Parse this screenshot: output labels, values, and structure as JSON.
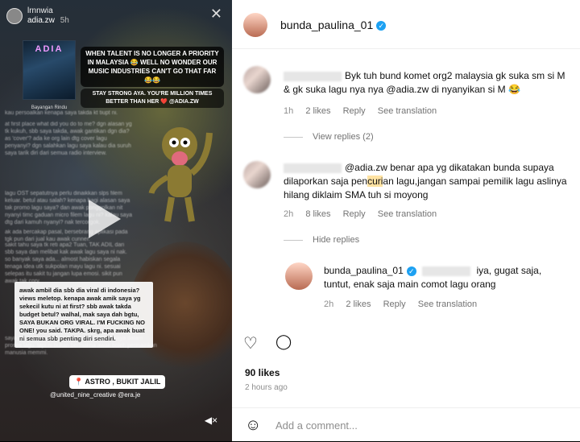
{
  "story": {
    "user_top": "lrnnwia",
    "user_handle": "adia.zw",
    "time": "5h",
    "album_title": "ADIA",
    "album_caption": "Bayangan Rindu",
    "quote_main": "WHEN TALENT IS NO LONGER A PRIORITY IN MALAYSIA 😂 WELL NO WONDER OUR MUSIC INDUSTRIES CAN'T GO THAT FAR 😂😂",
    "quote_sub": "STAY STRONG AYA. YOU'RE MILLION TIMES BETTER THAN HER ❤️ @ADIA.ZW",
    "body_blur": [
      "kau persoalkan kenapa saya takda kt tiupt ni.",
      "at first place what did you do to me? dgn alasan yg tk kukuh, sbb saya takda, awak gantikan dgn dia? as 'cover'? ada ke org lain dtg cover lagu penyanyi? dgn salahkan lagu saya kalau dia suruh saya tarik diri dari semua radio interview.",
      "lagu OST sepatutnya perlu dinaikkan slps filem keluar. betul atau salah? kenapa bagi alasan saya tak promo lagu saya? dan awak ponggolkan nit nyanyi timc gaduan micro filem lagu ni? kalau saya dtg dari kamuh nyanyi? nak tercorgok.",
      "ak ada bercakap pasal, bersebrang aplikasi pada tgk pun dari jual kau awak cunner.",
      "sakit tahu saya tk reti apa2 Tuan, TAK ADIL dari sbb saya dan melibat kak awak lagu saya ni nak. so banyak saya ada... almost habiskan segala tenaga idea utk sukpolan mayu lagu ni. sesuai selepas itu sakit tu jangan lupa emosi. sikit pun awak tak cory."
    ],
    "body_box": "awak ambil dia sbb dia viral di indonesia? views meletop. kenapa awak amik saya yg sekecil kutu ni at first? sbb awak takda budget betul? walhal, mak saya dah bgtu, SAYA BUKAN ORG VIRAL. I'M FUCKING NO ONE! you said. TAKPA. skrg, apa awak buat ni semua sbb penting diri sendiri.",
    "body_tail": "saya pun tahu awak dah byk bantu support saya dalam proses lagu. tapi ni bukan bermakna awak boleh permainkan manusia memmi.",
    "location_tag": "📍 ASTRO , BUKIT JALIL",
    "mention_tag": "@united_nine_creative @era.je"
  },
  "post": {
    "author": "bunda_paulina_01",
    "likes": "90 likes",
    "time_ago": "2 hours ago",
    "add_comment_placeholder": "Add a comment..."
  },
  "comments": [
    {
      "user": "",
      "text": "Byk tuh bund komet org2 malaysia gk suka sm si M & gk suka lagu nya nya @adia.zw di nyanyikan si M 😂",
      "time": "1h",
      "likes": "2 likes",
      "reply": "Reply",
      "translate": "See translation",
      "view_replies": "View replies (2)"
    },
    {
      "user": "",
      "text_pre": "@adia.zw benar apa yg dikatakan bunda supaya dilaporkan saja pen",
      "text_hl": "curi",
      "text_post": "an lagu,jangan sampai pemilik lagu aslinya hilang diklaim SMA tuh si moyong",
      "time": "2h",
      "likes": "8 likes",
      "reply": "Reply",
      "translate": "See translation",
      "hide_replies": "Hide replies"
    }
  ],
  "reply": {
    "user": "bunda_paulina_01",
    "text": "iya, gugat saja, tuntut, enak saja main comot lagu orang",
    "time": "2h",
    "likes": "2 likes",
    "reply": "Reply",
    "translate": "See translation"
  }
}
